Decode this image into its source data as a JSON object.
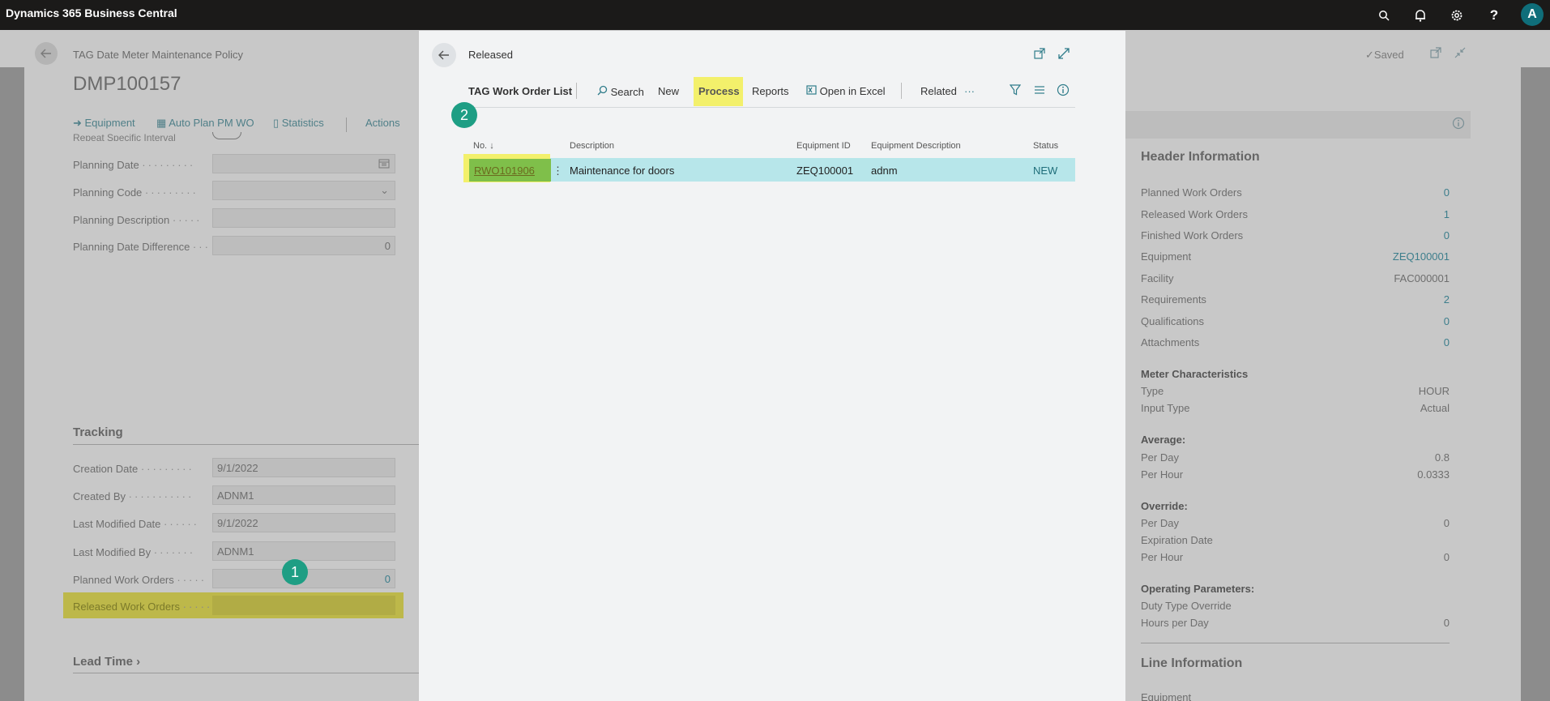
{
  "app": {
    "title": "Dynamics 365 Business Central",
    "avatar": "A"
  },
  "background": {
    "breadcrumb": "TAG Date Meter Maintenance Policy",
    "title": "DMP100157",
    "saved": "Saved",
    "actions": [
      "Equipment",
      "Auto Plan PM WO",
      "Statistics",
      "Actions"
    ],
    "cutoff_label": "Repeat Specific Interval",
    "fields": [
      {
        "label": "Planning Date",
        "value": ""
      },
      {
        "label": "Planning Code",
        "value": ""
      },
      {
        "label": "Planning Description",
        "value": ""
      },
      {
        "label": "Planning Date Difference",
        "value": "0"
      }
    ],
    "tracking": {
      "heading": "Tracking",
      "fields": [
        {
          "label": "Creation Date",
          "value": "9/1/2022"
        },
        {
          "label": "Created By",
          "value": "ADNM1"
        },
        {
          "label": "Last Modified Date",
          "value": "9/1/2022"
        },
        {
          "label": "Last Modified By",
          "value": "ADNM1"
        },
        {
          "label": "Planned Work Orders",
          "value": "0"
        },
        {
          "label": "Released Work Orders",
          "value": ""
        }
      ]
    },
    "lead_time": "Lead Time",
    "factbox": {
      "header_title": "Header Information",
      "rows": [
        {
          "label": "Planned Work Orders",
          "value": "0"
        },
        {
          "label": "Released Work Orders",
          "value": "1"
        },
        {
          "label": "Finished Work Orders",
          "value": "0"
        },
        {
          "label": "Equipment",
          "value": "ZEQ100001"
        },
        {
          "label": "Facility",
          "value": "FAC000001"
        },
        {
          "label": "Requirements",
          "value": "2"
        },
        {
          "label": "Qualifications",
          "value": "0"
        },
        {
          "label": "Attachments",
          "value": "0"
        }
      ],
      "meter_title": "Meter Characteristics",
      "meter": [
        {
          "label": "Type",
          "value": "HOUR"
        },
        {
          "label": "Input Type",
          "value": "Actual"
        }
      ],
      "average_title": "Average:",
      "average": [
        {
          "label": "Per Day",
          "value": "0.8"
        },
        {
          "label": "Per Hour",
          "value": "0.0333"
        }
      ],
      "override_title": "Override:",
      "override": [
        {
          "label": "Per Day",
          "value": "0"
        },
        {
          "label": "Expiration Date",
          "value": ""
        },
        {
          "label": "Per Hour",
          "value": "0"
        }
      ],
      "operating_title": "Operating Parameters:",
      "operating": [
        {
          "label": "Duty Type Override",
          "value": ""
        },
        {
          "label": "Hours per Day",
          "value": "0"
        }
      ],
      "line_title": "Line Information",
      "line_first": "Equipment"
    }
  },
  "dialog": {
    "caption": "Released",
    "list_title": "TAG Work Order List",
    "toolbar": {
      "search": "Search",
      "new": "New",
      "process": "Process",
      "reports": "Reports",
      "open_excel": "Open in Excel",
      "related": "Related",
      "more": "···"
    },
    "columns": [
      "No.",
      "Description",
      "Equipment ID",
      "Equipment Description",
      "Status"
    ],
    "sort_indicator": "↓",
    "rows": [
      {
        "no": "RWO101906",
        "description": "Maintenance for doors",
        "equipment_id": "ZEQ100001",
        "equipment_description": "adnm",
        "status": "NEW"
      }
    ]
  },
  "annotations": {
    "badge1": "1",
    "badge2": "2"
  },
  "colors": {
    "accent": "#0f6e7a",
    "highlight": "#f3f06b",
    "selected_row": "#b7e6ea",
    "badge": "#1e9e84"
  }
}
